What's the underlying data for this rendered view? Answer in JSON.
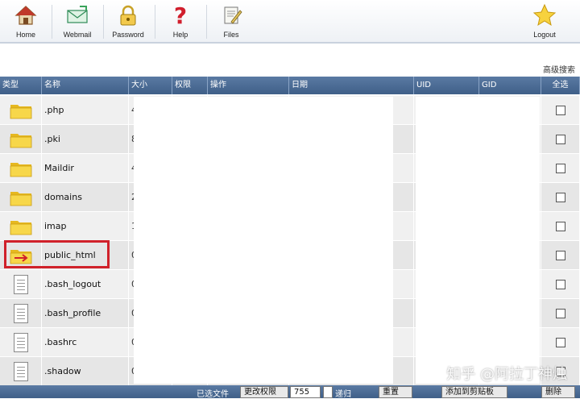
{
  "toolbar": {
    "home": "Home",
    "webmail": "Webmail",
    "password": "Password",
    "help": "Help",
    "files": "Files",
    "logout": "Logout"
  },
  "advanced_search": "高级搜索",
  "columns": {
    "type": "类型",
    "name": "名称",
    "size": "大小",
    "perm": "权限",
    "op": "操作",
    "date": "日期",
    "uid": "UID",
    "gid": "GID",
    "select_all": "全选"
  },
  "rows": [
    {
      "icon": "folder-icon",
      "name": ".php",
      "size": "4"
    },
    {
      "icon": "folder-icon",
      "name": ".pki",
      "size": "8"
    },
    {
      "icon": "folder-icon",
      "name": "Maildir",
      "size": "4"
    },
    {
      "icon": "folder-icon",
      "name": "domains",
      "size": "2"
    },
    {
      "icon": "folder-icon",
      "name": "imap",
      "size": "1"
    },
    {
      "icon": "folder-link-icon",
      "name": "public_html",
      "size": "0"
    },
    {
      "icon": "file-icon",
      "name": ".bash_logout",
      "size": "0"
    },
    {
      "icon": "file-icon",
      "name": ".bash_profile",
      "size": "0"
    },
    {
      "icon": "file-icon",
      "name": ".bashrc",
      "size": "0"
    },
    {
      "icon": "file-icon",
      "name": ".shadow",
      "size": "0"
    }
  ],
  "footer": {
    "selected_files": "已选文件",
    "change_perm": "更改权限",
    "perm_value": "755",
    "recursive": "递归",
    "reset": "重置",
    "add_clipboard": "添加到剪贴板",
    "delete": "删除"
  },
  "watermark": "知乎 @阿拉丁神烛",
  "colors": {
    "header_bg": "#4a6b94",
    "highlight": "#d0212a",
    "folder": "#f5cf3a"
  }
}
